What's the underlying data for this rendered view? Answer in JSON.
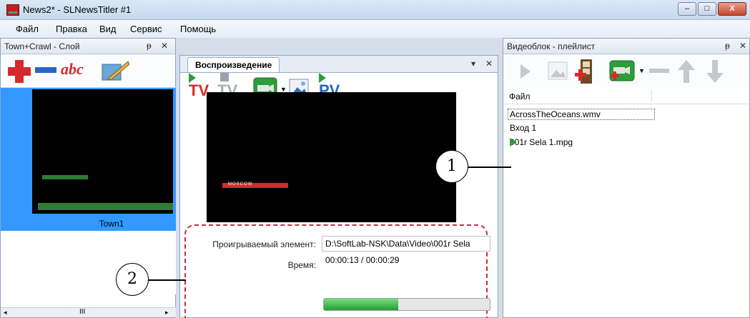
{
  "window": {
    "title": "News2* - SLNewsTitler #1"
  },
  "menu": [
    "Файл",
    "Правка",
    "Вид",
    "Сервис",
    "Помощь"
  ],
  "left_panel": {
    "title": "Town+Crawl - Слой",
    "pin": "ᵽ",
    "close": "✕",
    "abc": "abc",
    "layer_label": "Town1",
    "scroll_dots": "III"
  },
  "center_panel": {
    "tab": "Воспроизведение",
    "pin": "▾",
    "close": "✕",
    "tv_label": "TV",
    "tv_off_label": "TV",
    "pv_label": "PV",
    "preview_text": "MOSCOW",
    "playing_label": "Проигрываемый элемент:",
    "playing_value": "D:\\SoftLab-NSK\\Data\\Video\\001r Sela",
    "time_label": "Время:",
    "time_value": "00:00:13 / 00:00:29",
    "progress": 0.45
  },
  "right_panel": {
    "title": "Видеоблок - плейлист",
    "pin": "ᵽ",
    "close": "✕",
    "column": "Файл",
    "items": [
      "AcrossTheOceans.wmv",
      "Вход 1",
      "001r Sela 1.mpg"
    ]
  },
  "callouts": [
    "1",
    "2"
  ],
  "colors": {
    "accent_red": "#d62a2a",
    "accent_green": "#2e9d3a",
    "selection": "#3399ff"
  }
}
